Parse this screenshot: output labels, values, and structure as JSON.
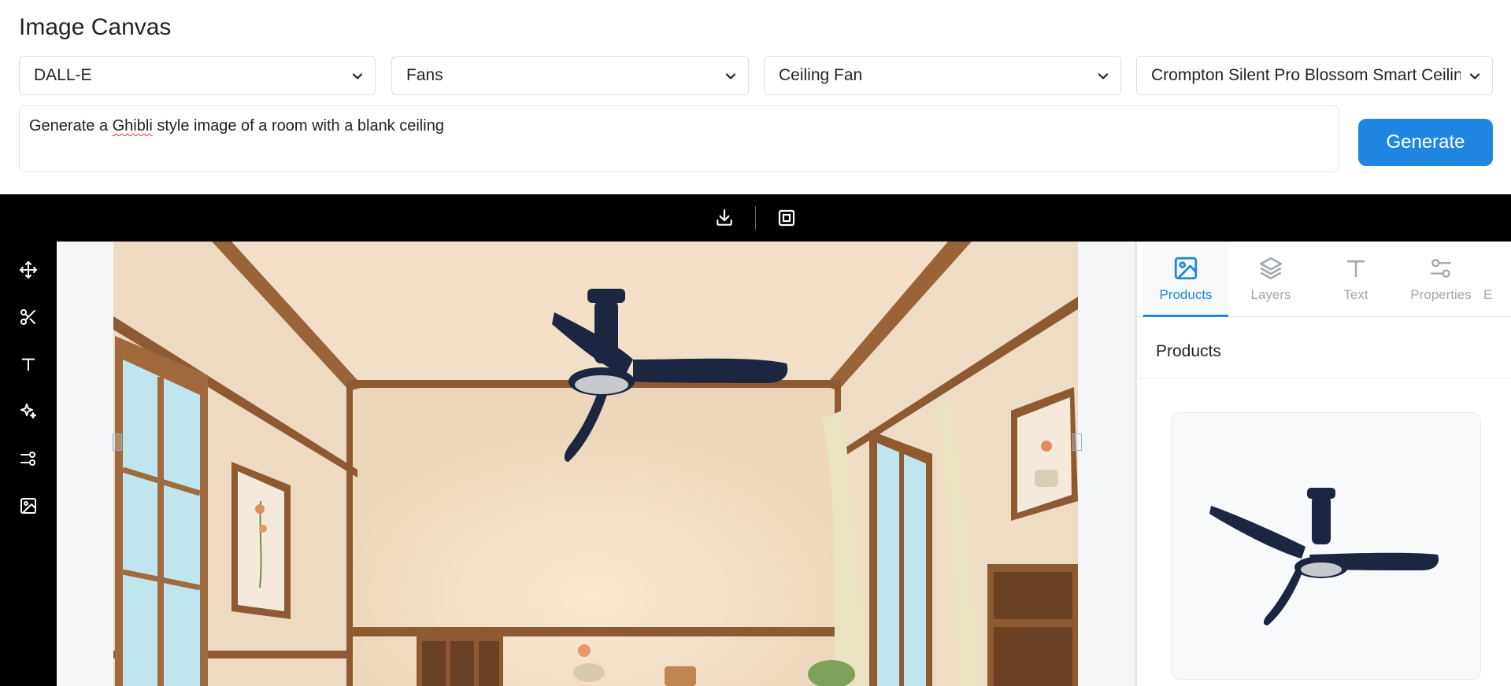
{
  "app": {
    "title": "Image Canvas"
  },
  "selects": {
    "model": "DALL-E",
    "category": "Fans",
    "subcategory": "Ceiling Fan",
    "product": "Crompton Silent Pro Blossom Smart Ceilin"
  },
  "prompt": {
    "before": "Generate a ",
    "misspelled": "Ghibli",
    "after": " style image of a room with a blank ceiling"
  },
  "actions": {
    "generate_label": "Generate"
  },
  "toolbar": {
    "icons": [
      "download-icon",
      "fit-to-frame-icon"
    ]
  },
  "left_tools": [
    "move-icon",
    "scissors-icon",
    "text-icon",
    "sparkles-icon",
    "sliders-icon",
    "image-icon"
  ],
  "panel": {
    "tabs": [
      {
        "label": "Products",
        "icon": "image-icon",
        "active": true
      },
      {
        "label": "Layers",
        "icon": "layers-icon",
        "active": false
      },
      {
        "label": "Text",
        "icon": "text-icon",
        "active": false
      },
      {
        "label": "Properties",
        "icon": "sliders-icon",
        "active": false
      },
      {
        "label": "E",
        "icon": "",
        "active": false
      }
    ],
    "title": "Products"
  },
  "colors": {
    "accent": "#1f87e0",
    "toolbar_bg": "#000000",
    "fan": "#1c2640"
  }
}
